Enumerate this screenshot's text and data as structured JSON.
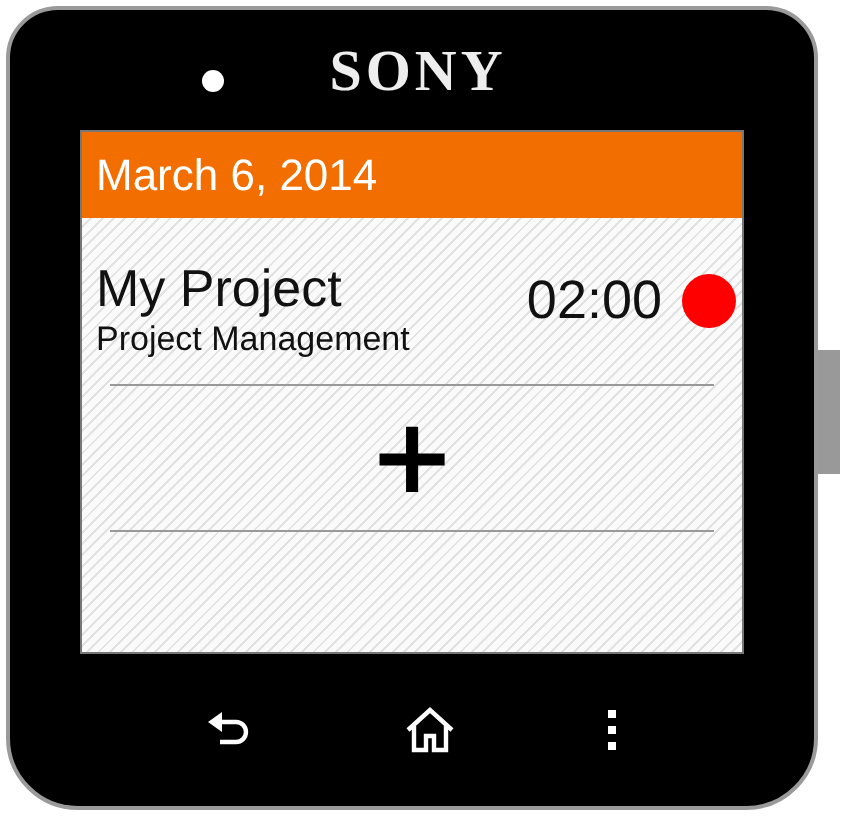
{
  "device": {
    "brand": "SONY"
  },
  "header": {
    "date": "March 6, 2014"
  },
  "projects": [
    {
      "name": "My Project",
      "category": "Project Management",
      "time": "02:00",
      "running": true
    }
  ],
  "add_button": {
    "label": "+"
  }
}
